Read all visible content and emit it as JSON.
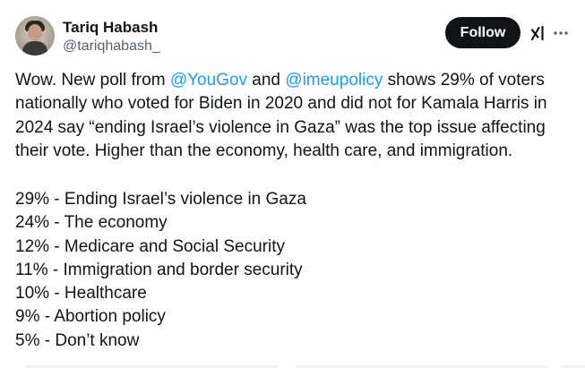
{
  "user": {
    "display_name": "Tariq Habash",
    "handle": "@tariqhabash_"
  },
  "actions": {
    "follow_label": "Follow",
    "grok_icon": "grok-icon",
    "more_icon": "more-icon"
  },
  "tweet": {
    "text_1": "Wow. New poll from ",
    "mention_1": "@YouGov",
    "text_2": " and ",
    "mention_2": "@imeupolicy",
    "text_3": " shows 29% of voters nationally who voted for Biden in 2020 and did not for Kamala Harris in 2024 say “ending Israel’s violence in Gaza” was the top issue affecting their vote. Higher than the economy, health care, and immigration.",
    "list": [
      "29% - Ending Israel’s violence in Gaza",
      "24% - The economy",
      "12% - Medicare and Social Security",
      "11% - Immigration and border security",
      "10% - Healthcare",
      "9% - Abortion policy",
      "5% - Don’t know"
    ]
  },
  "colors": {
    "link": "#1d9bf0",
    "text": "#0f1419",
    "secondary": "#536471",
    "button": "#0f1419"
  }
}
